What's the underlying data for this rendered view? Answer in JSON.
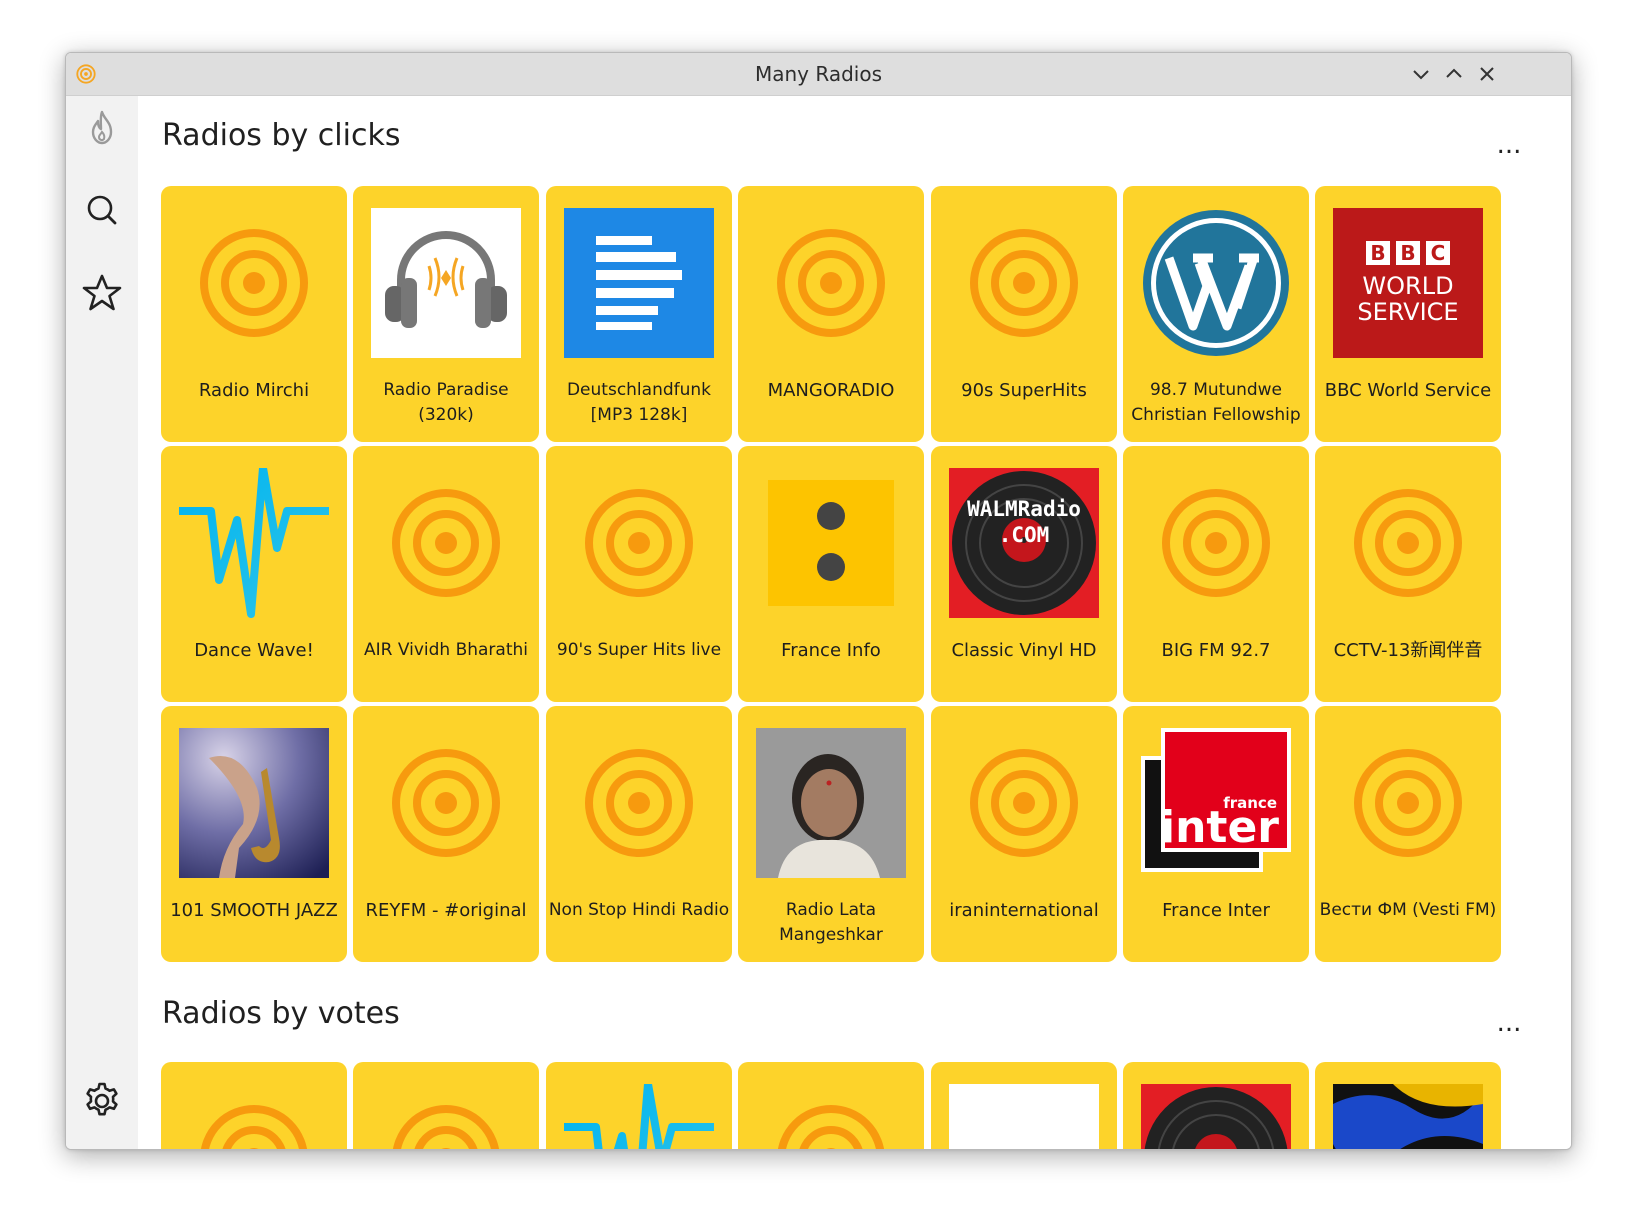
{
  "window": {
    "title": "Many Radios"
  },
  "sidebar": {
    "items": [
      "hot",
      "search",
      "favorites",
      "settings"
    ]
  },
  "sections": [
    {
      "title": "Radios by clicks",
      "more_label": "...",
      "stations": [
        {
          "name": "Radio Mirchi",
          "icon": "radio-default-icon"
        },
        {
          "name": "Radio Paradise (320k)",
          "icon": "headphones-icon"
        },
        {
          "name": "Deutschlandfunk [MP3 128k]",
          "icon": "text-lines-icon"
        },
        {
          "name": "MANGORADIO",
          "icon": "radio-default-icon"
        },
        {
          "name": "90s SuperHits",
          "icon": "radio-default-icon"
        },
        {
          "name": "98.7 Mutundwe Christian Fellowship",
          "icon": "wordpress-icon"
        },
        {
          "name": "BBC World Service",
          "icon": "bbc-world-service-icon",
          "logo_text": [
            "BBC",
            "WORLD",
            "SERVICE"
          ]
        },
        {
          "name": "Dance Wave!",
          "icon": "pulse-wave-icon"
        },
        {
          "name": "AIR Vividh Bharathi",
          "icon": "radio-default-icon"
        },
        {
          "name": "90's Super Hits live",
          "icon": "radio-default-icon"
        },
        {
          "name": "France Info",
          "icon": "two-dots-icon"
        },
        {
          "name": "Classic Vinyl HD",
          "icon": "vinyl-record-icon",
          "logo_text": [
            "WALMRadio",
            ".COM"
          ]
        },
        {
          "name": "BIG FM 92.7",
          "icon": "radio-default-icon"
        },
        {
          "name": "CCTV-13新闻伴音",
          "icon": "radio-default-icon"
        },
        {
          "name": "101 SMOOTH JAZZ",
          "icon": "saxophone-photo-icon"
        },
        {
          "name": "REYFM - #original",
          "icon": "radio-default-icon"
        },
        {
          "name": "Non Stop Hindi Radio",
          "icon": "radio-default-icon"
        },
        {
          "name": "Radio Lata Mangeshkar",
          "icon": "portrait-photo-icon"
        },
        {
          "name": "iraninternational",
          "icon": "radio-default-icon"
        },
        {
          "name": "France Inter",
          "icon": "france-inter-icon",
          "logo_text": [
            "france",
            "inter"
          ]
        },
        {
          "name": "Вести ФМ (Vesti FM)",
          "icon": "radio-default-icon"
        }
      ]
    },
    {
      "title": "Radios by votes",
      "more_label": "...",
      "stations": [
        {
          "icon": "radio-default-icon"
        },
        {
          "icon": "radio-default-icon"
        },
        {
          "icon": "pulse-wave-icon"
        },
        {
          "icon": "radio-default-icon"
        },
        {
          "icon": "white-logo-icon"
        },
        {
          "icon": "vinyl-record-icon"
        },
        {
          "icon": "abstract-art-icon"
        }
      ]
    }
  ],
  "colors": {
    "card": "#fdd32a",
    "accent": "#f79a0e",
    "sidebar": "#f2f2f2",
    "titlebar": "#dedede"
  }
}
